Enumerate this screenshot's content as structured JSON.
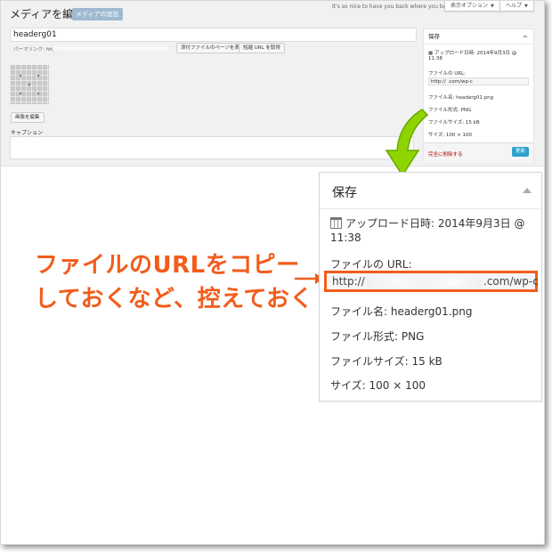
{
  "small": {
    "title": "メディアを編集",
    "add_new": "メディアの追加",
    "thanks": "It's so nice to have you back where you belong",
    "screen_options": "表示オプション",
    "help": "ヘルプ",
    "name_value": "headerg01",
    "permalink_label": "パーマリンク: http://",
    "view_attachment": "添付ファイルのページを表示",
    "get_short": "短縮 URL を取得",
    "edit_image": "画像を編集",
    "caption": "キャプション",
    "save_title": "保存",
    "uploaded": "アップロード日時: 2014年9月3日 @",
    "uploaded_time": "11:38",
    "file_url_label": "ファイルの URL:",
    "file_url_value": "http://                     .com/wp-c",
    "file_name": "ファイル名: headerg01.png",
    "file_type": "ファイル形式: PNG",
    "file_size": "ファイルサイズ: 15 kB",
    "dimensions": "サイズ: 100 × 100",
    "delete": "完全に削除する",
    "update": "更新"
  },
  "annotation": {
    "line1": "ファイルのURLをコピー",
    "line2": "しておくなど、控えておく"
  },
  "big": {
    "save_title": "保存",
    "uploaded": "アップロード日時: 2014年9月3日 @",
    "uploaded_time": "11:38",
    "file_url_label": "ファイルの URL:",
    "file_url_prefix": "http://",
    "file_url_suffix": ".com/wp-c",
    "file_name": "ファイル名: headerg01.png",
    "file_type": "ファイル形式: PNG",
    "file_size": "ファイルサイズ: 15 kB",
    "dimensions": "サイズ: 100 × 100"
  },
  "colors": {
    "accent": "#f25c1c",
    "arrow_green": "#8fd400",
    "update_blue": "#2ea2cc"
  }
}
